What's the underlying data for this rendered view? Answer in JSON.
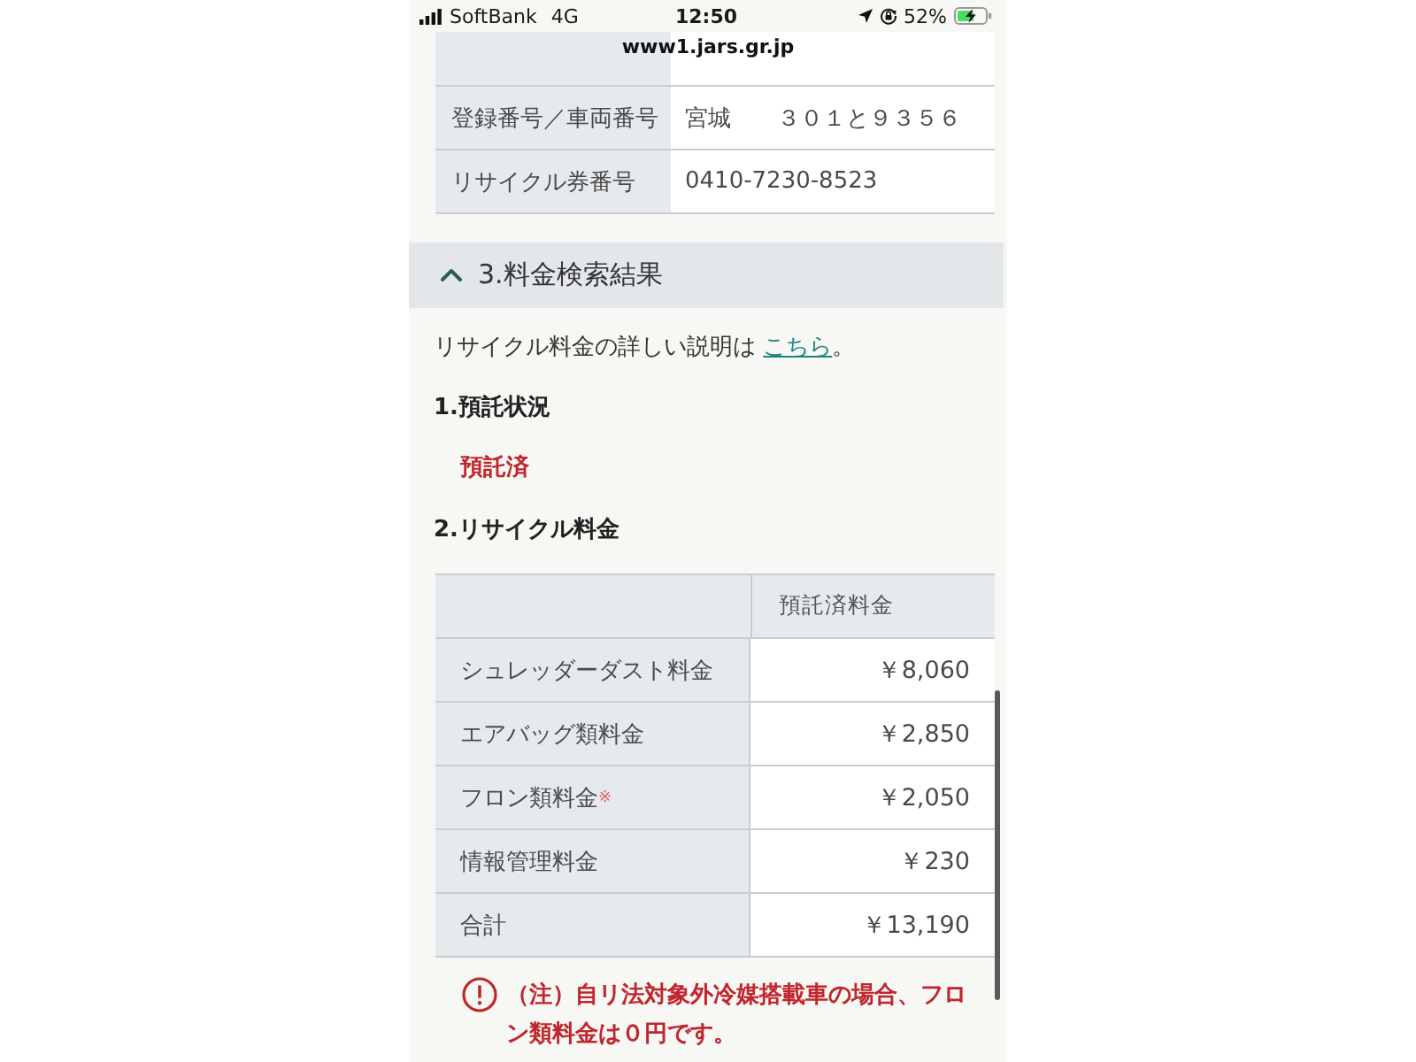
{
  "status_bar": {
    "carrier": "SoftBank",
    "network": "4G",
    "time": "12:50",
    "battery": "52%"
  },
  "address_bar": {
    "url": "www1.jars.gr.jp"
  },
  "vehicle_table": {
    "rows": [
      {
        "label": "登録番号／車両番号",
        "value": "宮城　　３０１と９３５６"
      },
      {
        "label": "リサイクル券番号",
        "value": "0410-7230-8523"
      }
    ]
  },
  "section": {
    "title": "3.料金検索結果",
    "expanded": true,
    "intro": "リサイクル料金の詳しい説明は ",
    "link": "こちら",
    "intro_end": "。",
    "deposit": {
      "heading": "1.預託状況",
      "status": "預託済"
    },
    "fees": {
      "heading": "2.リサイクル料金",
      "column_header": "預託済料金",
      "rows": [
        {
          "label": "シュレッダーダスト料金",
          "amount": "￥8,060"
        },
        {
          "label": "エアバッグ類料金",
          "amount": "￥2,850"
        },
        {
          "label": "フロン類料金$^{※}$",
          "amount": "￥2,050"
        },
        {
          "label": "情報管理料金",
          "amount": "￥230"
        },
        {
          "label": "合計",
          "amount": "￥13,190"
        }
      ]
    },
    "note": {
      "text": "（注）自リ法対象外冷媒搭載車の場合、フロン類料金は０円です。"
    }
  }
}
